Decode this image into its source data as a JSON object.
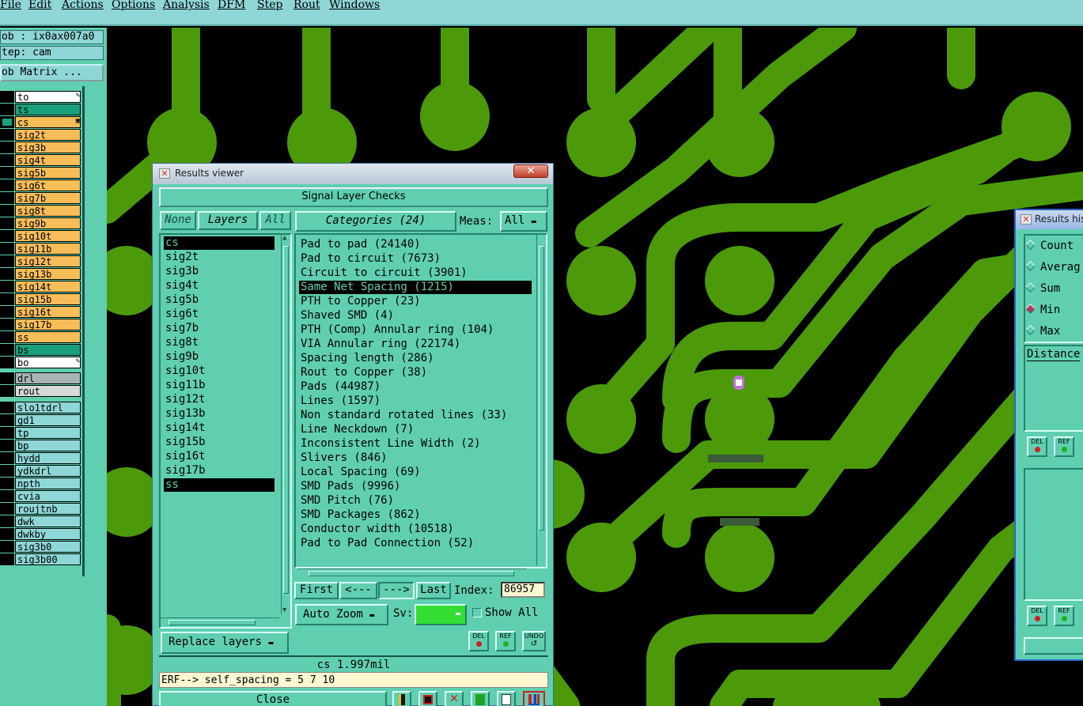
{
  "menubar": {
    "items": [
      "File",
      "Edit",
      "Actions",
      "Options",
      "Analysis",
      "DFM",
      "Step",
      "Rout",
      "Windows"
    ]
  },
  "job_panel": {
    "job": "ob : ix0ax007a0",
    "step": "tep: cam",
    "matrix_button": "ob Matrix ..."
  },
  "layers_panel": {
    "board_layers": [
      {
        "name": "to",
        "color": "#ffffff",
        "icon": "pencil-icon"
      },
      {
        "name": "ts",
        "color": "#1aa07a"
      },
      {
        "name": "cs",
        "color": "#f7bd58",
        "icon": "box-icon",
        "active": true
      },
      {
        "name": "sig2t",
        "color": "#f7bd58"
      },
      {
        "name": "sig3b",
        "color": "#f7bd58"
      },
      {
        "name": "sig4t",
        "color": "#f7bd58"
      },
      {
        "name": "sig5b",
        "color": "#f7bd58"
      },
      {
        "name": "sig6t",
        "color": "#f7bd58"
      },
      {
        "name": "sig7b",
        "color": "#f7bd58"
      },
      {
        "name": "sig8t",
        "color": "#f7bd58"
      },
      {
        "name": "sig9b",
        "color": "#f7bd58"
      },
      {
        "name": "sig10t",
        "color": "#f7bd58"
      },
      {
        "name": "sig11b",
        "color": "#f7bd58"
      },
      {
        "name": "sig12t",
        "color": "#f7bd58"
      },
      {
        "name": "sig13b",
        "color": "#f7bd58"
      },
      {
        "name": "sig14t",
        "color": "#f7bd58"
      },
      {
        "name": "sig15b",
        "color": "#f7bd58"
      },
      {
        "name": "sig16t",
        "color": "#f7bd58"
      },
      {
        "name": "sig17b",
        "color": "#f7bd58"
      },
      {
        "name": "ss",
        "color": "#f7bd58"
      },
      {
        "name": "bs",
        "color": "#1aa07a"
      },
      {
        "name": "bo",
        "color": "#ffffff",
        "icon": "pencil-icon"
      }
    ],
    "drill_layers": [
      {
        "name": "drl",
        "color": "#a9b4b4"
      },
      {
        "name": "rout",
        "color": "#d8d8d8"
      }
    ],
    "misc_layers": [
      {
        "name": "slo1tdrl",
        "color": "#8fd6d6"
      },
      {
        "name": "gd1",
        "color": "#8fd6d6"
      },
      {
        "name": "tp",
        "color": "#8fd6d6"
      },
      {
        "name": "bp",
        "color": "#8fd6d6"
      },
      {
        "name": "hydd",
        "color": "#8fd6d6"
      },
      {
        "name": "ydkdrl",
        "color": "#8fd6d6"
      },
      {
        "name": "npth",
        "color": "#8fd6d6"
      },
      {
        "name": "cvia",
        "color": "#8fd6d6"
      },
      {
        "name": "roujtnb",
        "color": "#8fd6d6"
      },
      {
        "name": "dwk",
        "color": "#8fd6d6"
      },
      {
        "name": "dwkby",
        "color": "#8fd6d6"
      },
      {
        "name": "sig3b0",
        "color": "#8fd6d6"
      },
      {
        "name": "sig3b00",
        "color": "#8fd6d6"
      }
    ]
  },
  "results_viewer": {
    "window_title": "Results viewer",
    "header": "Signal Layer Checks",
    "none_button": "None",
    "layers_button": "Layers",
    "all_button": "All",
    "layers": [
      "cs",
      "sig2t",
      "sig3b",
      "sig4t",
      "sig5b",
      "sig6t",
      "sig7b",
      "sig8t",
      "sig9b",
      "sig10t",
      "sig11b",
      "sig12t",
      "sig13b",
      "sig14t",
      "sig15b",
      "sig16t",
      "sig17b",
      "ss"
    ],
    "selected_layers": [
      "cs",
      "ss"
    ],
    "categories_button": "Categories (24)",
    "meas_label": "Meas:",
    "meas_value": "All",
    "categories": [
      "Pad to pad (24140)",
      "Pad to circuit (7673)",
      "Circuit to circuit (3901)",
      "Same Net Spacing (1215)",
      "PTH to Copper (23)",
      "Shaved SMD (4)",
      "PTH (Comp) Annular ring (104)",
      "VIA Annular ring (22174)",
      "Spacing length (286)",
      "Rout to Copper (38)",
      "Pads (44987)",
      "Lines (1597)",
      "Non standard rotated lines (33)",
      "Line Neckdown (7)",
      "Inconsistent Line Width (2)",
      "Slivers (846)",
      "Local Spacing (69)",
      "SMD Pads (9996)",
      "SMD Pitch (76)",
      "SMD Packages (862)",
      "Conductor width (10518)",
      "Pad to Pad Connection (52)"
    ],
    "selected_category": "Same Net Spacing (1215)",
    "nav": {
      "first": "First",
      "prev": "<---",
      "next": "--->",
      "last": "Last",
      "index_label": "Index:",
      "index_value": "86957"
    },
    "auto_zoom": "Auto Zoom",
    "sv_label": "Sv:",
    "sv_color": "#33dd33",
    "show_all": "Show All",
    "replace_layers": "Replace layers",
    "del_label": "DEL",
    "ref_label": "REF",
    "undo_label": "UNDO",
    "status": "cs 1.997mil",
    "erf": "ERF--> self_spacing = 5 7 10",
    "close": "Close"
  },
  "results_histogram": {
    "window_title": "Results his",
    "options": [
      "Count",
      "Averag",
      "Sum",
      "Min",
      "Max"
    ],
    "selected": "Min",
    "field_label": "Distance",
    "del_label": "DEL",
    "ref_label": "REF"
  },
  "colors": {
    "copper": "#4c9a0a",
    "panel": "#5fcfb0",
    "menubar": "#8fd6d6",
    "highlight": "#c070e0"
  }
}
